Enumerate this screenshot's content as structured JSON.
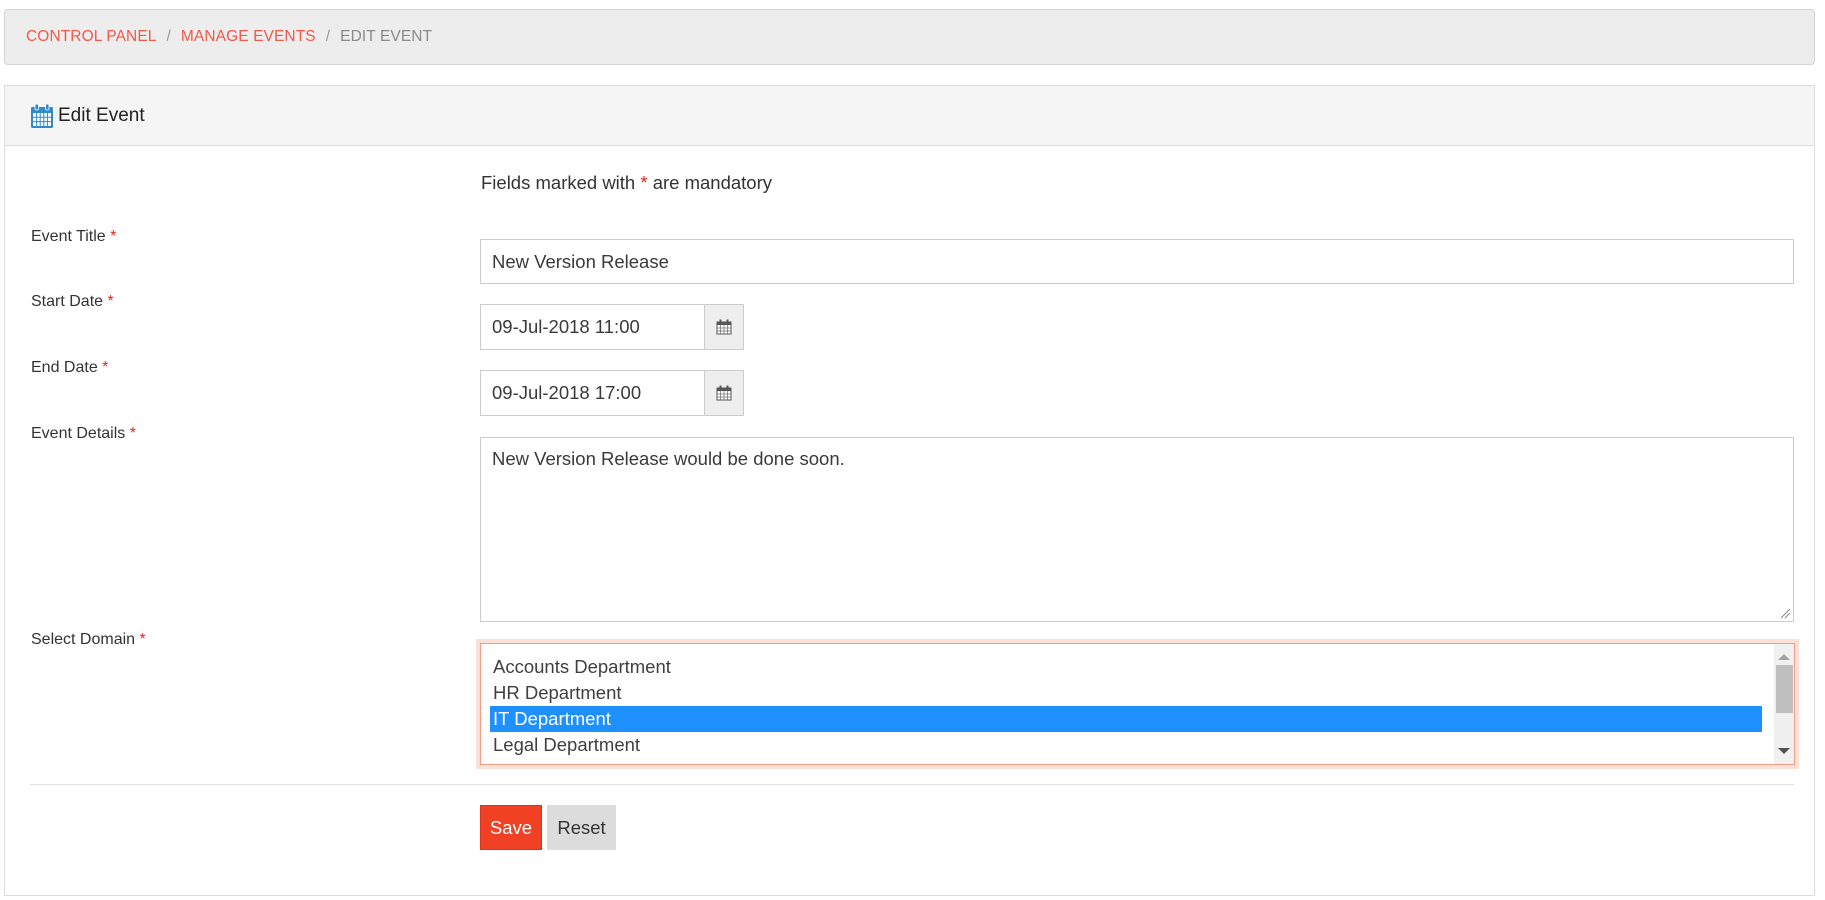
{
  "breadcrumb": {
    "items": [
      {
        "label": "CONTROL PANEL"
      },
      {
        "label": "MANAGE EVENTS"
      }
    ],
    "separator": "/",
    "current": "EDIT EVENT"
  },
  "panel": {
    "icon": "calendar-icon",
    "title": "Edit Event"
  },
  "form": {
    "mandatory_note": {
      "prefix": "Fields marked with",
      "marker": "*",
      "suffix": "are mandatory"
    },
    "required_marker": "*",
    "event_title": {
      "label": "Event Title",
      "value": "New Version Release"
    },
    "start_date": {
      "label": "Start Date",
      "value": "09-Jul-2018 11:00",
      "addon_icon": "calendar-icon"
    },
    "end_date": {
      "label": "End Date",
      "value": "09-Jul-2018 17:00",
      "addon_icon": "calendar-icon"
    },
    "event_details": {
      "label": "Event Details",
      "value": "New Version Release would be done soon."
    },
    "select_domain": {
      "label": "Select Domain",
      "options": [
        {
          "label": "Accounts Department",
          "selected": false
        },
        {
          "label": "HR Department",
          "selected": false
        },
        {
          "label": "IT Department",
          "selected": true
        },
        {
          "label": "Legal Department",
          "selected": false
        }
      ],
      "scroll_position": 0.0
    }
  },
  "actions": {
    "save_label": "Save",
    "reset_label": "Reset"
  },
  "colors": {
    "accent": "#f04124",
    "link": "#f0584a",
    "required": "#e8261e",
    "selection": "#1e90ff",
    "icon_blue": "#2f8bc9"
  }
}
